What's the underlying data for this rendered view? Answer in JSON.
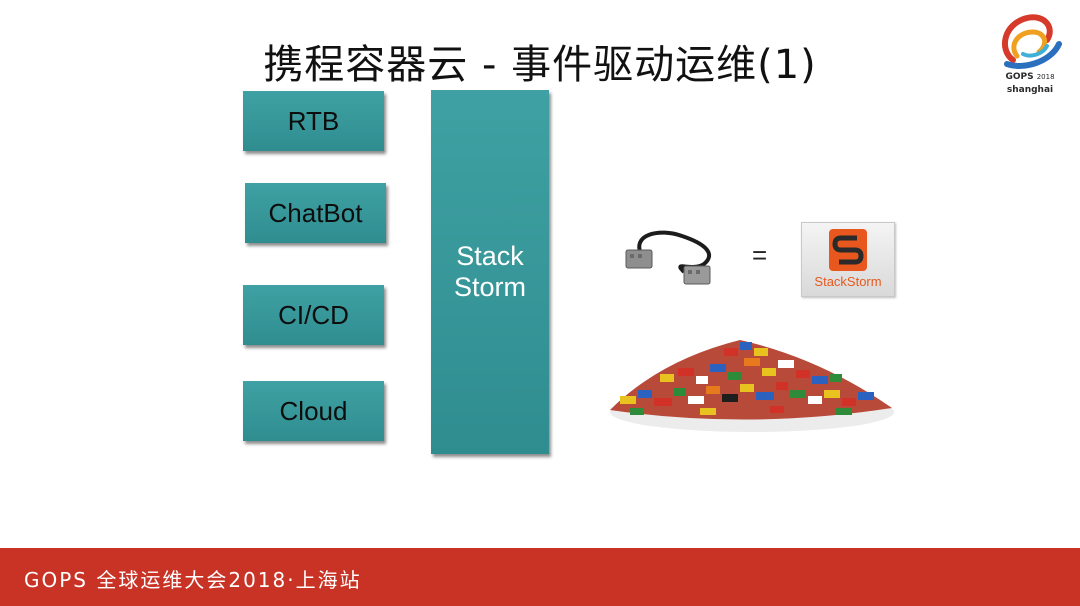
{
  "slide": {
    "title": "携程容器云 - 事件驱动运维(1)"
  },
  "logo": {
    "event": "GOPS",
    "year": "2018",
    "city": "shanghai"
  },
  "left_boxes": [
    {
      "label": "RTB"
    },
    {
      "label": "ChatBot"
    },
    {
      "label": "CI/CD"
    },
    {
      "label": "Cloud"
    }
  ],
  "center_box": {
    "line1": "Stack",
    "line2": "Storm"
  },
  "equation": {
    "operator": "="
  },
  "stackstorm_logo": {
    "text": "StackStorm"
  },
  "footer": {
    "text": "GOPS 全球运维大会2018·上海站"
  },
  "colors": {
    "teal": "#3a9a9c",
    "footer_red": "#c93326",
    "stackstorm_orange": "#e8581e"
  }
}
